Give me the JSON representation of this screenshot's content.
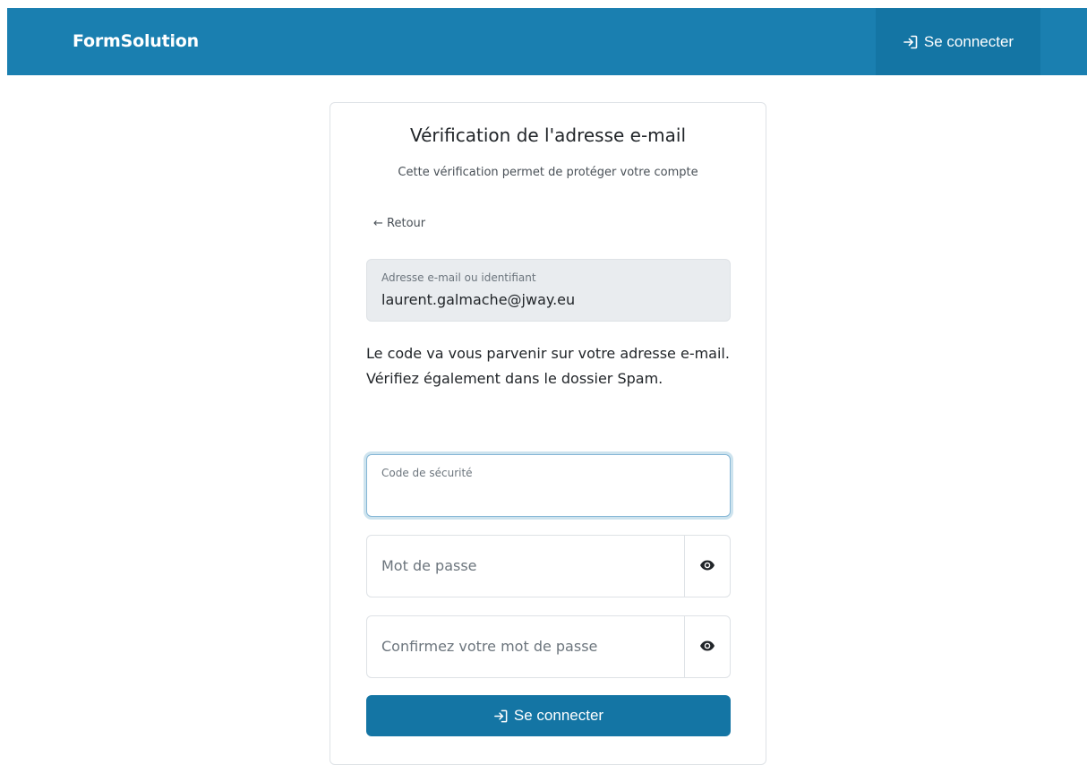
{
  "header": {
    "brand": "FormSolution",
    "login_label": "Se connecter",
    "login_icon": "sign-in-icon"
  },
  "card": {
    "title": "Vérification de l'adresse e-mail",
    "subtitle": "Cette vérification permet de protéger votre compte",
    "back_label": "← Retour",
    "email_field": {
      "label": "Adresse e-mail ou identifiant",
      "value": "laurent.galmache@jway.eu"
    },
    "info_text": "Le code va vous parvenir sur votre adresse e-mail. Vérifiez également dans le dossier Spam.",
    "code_field": {
      "label": "Code de sécurité",
      "value": ""
    },
    "password_field": {
      "placeholder": "Mot de passe",
      "icon": "eye-icon"
    },
    "confirm_field": {
      "placeholder": "Confirmez votre mot de passe",
      "icon": "eye-icon"
    },
    "submit_label": "Se connecter",
    "submit_icon": "sign-in-icon"
  },
  "colors": {
    "primary": "#1a7fb0",
    "primary_dark": "#1475a4",
    "readonly_bg": "#e9ecef"
  }
}
